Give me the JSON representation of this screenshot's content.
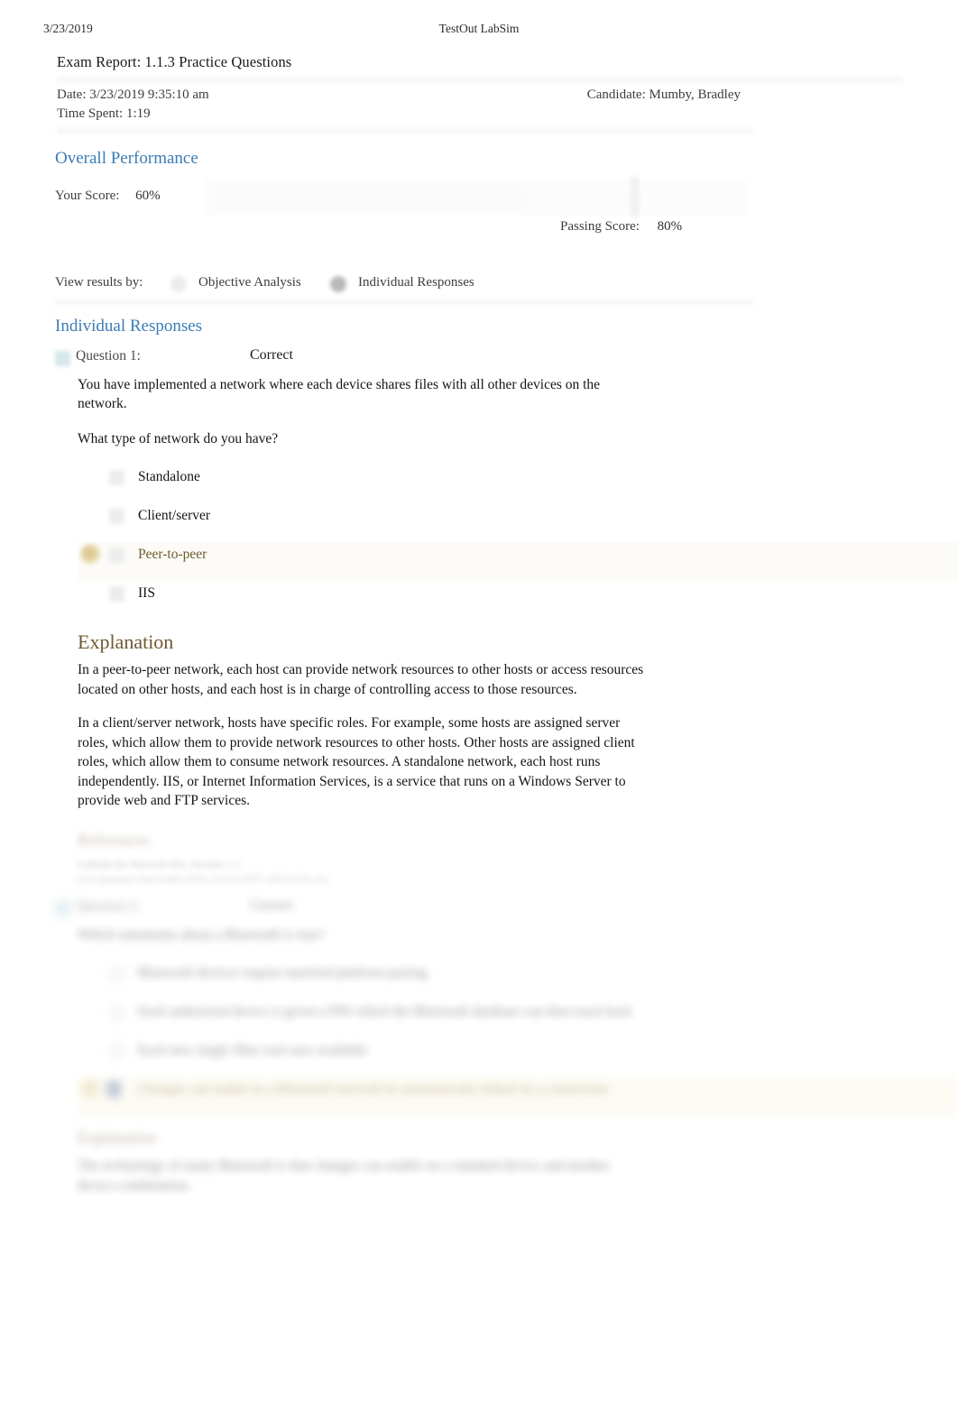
{
  "print_header": {
    "date": "3/23/2019",
    "app_title": "TestOut LabSim"
  },
  "report": {
    "title": "Exam Report: 1.1.3 Practice Questions",
    "date_line": "Date: 3/23/2019 9:35:10 am",
    "time_spent_line": "Time Spent: 1:19",
    "candidate_line": "Candidate: Mumby, Bradley"
  },
  "overall_performance": {
    "heading": "Overall Performance",
    "your_score_label": "Your Score:",
    "your_score_value": "60%",
    "passing_score_label": "Passing Score:",
    "passing_score_value": "80%",
    "score_percent": 60,
    "passing_percent": 80
  },
  "view_results_by": {
    "label": "View results by:",
    "options": [
      {
        "label": "Objective Analysis",
        "selected": false
      },
      {
        "label": "Individual Responses",
        "selected": true
      }
    ]
  },
  "individual_responses": {
    "heading": "Individual Responses",
    "questions": [
      {
        "label": "Question 1:",
        "status": "Correct",
        "stem_lines": [
          "You have implemented a network where each device shares files with all other devices on the network.",
          "What type of network do you have?"
        ],
        "options": [
          {
            "label": "Standalone",
            "chosen": false
          },
          {
            "label": "Client/server",
            "chosen": false
          },
          {
            "label": "Peer-to-peer",
            "chosen": true
          },
          {
            "label": "IIS",
            "chosen": false
          }
        ],
        "explanation_heading": "Explanation",
        "explanation_paragraphs": [
          "In a peer-to-peer network, each host can provide network resources to other hosts or access resources located on other hosts, and each host is in charge of controlling access to those resources.",
          "In a client/server network, hosts have specific roles. For example, some hosts are assigned server roles, which allow them to provide network resources to other hosts. Other hosts are assigned client roles, which allow them to consume network resources. A standalone network, each host runs independently. IIS, or Internet Information Services, is a service that runs on a Windows Server to provide web and FTP services."
        ],
        "references_heading": "References",
        "references_lines": [
          "LabSim for Network Pro, Section 1.1.",
          "[All Questions NetworkPro2018_v6.exm NET_DEVICES_01]"
        ]
      },
      {
        "label": "Question 2:",
        "status": "Correct",
        "stem_lines": [
          "Which statements about a Bluetooth is true?"
        ],
        "options": [
          {
            "label": "Bluetooth devices require matched platform pairing",
            "chosen": false
          },
          {
            "label": "Each authorized device is given a PIN which the Bluetooth database can then track back",
            "chosen": false
          },
          {
            "label": "Each new single filter tool uses available",
            "chosen": false
          },
          {
            "label": "Changes can enable in a Bluetooth network be automatically linked on a connection",
            "chosen": true
          }
        ],
        "explanation_heading": "Explanation",
        "explanation_paragraphs": [
          "The technology of many Bluetooth is that changes can enable on a standard device and another device combination."
        ]
      }
    ]
  },
  "colors": {
    "section_heading_blue": "#3c7cb5",
    "explanation_brown": "#6f5a31",
    "chosen_option_text": "#6e5a2c",
    "page_background": "#ffffff"
  }
}
